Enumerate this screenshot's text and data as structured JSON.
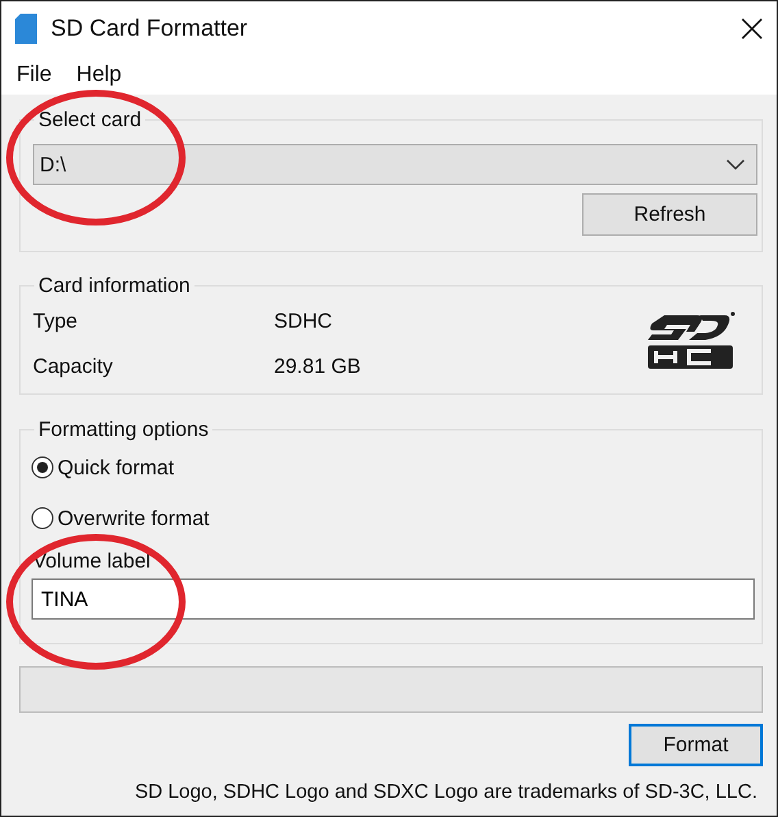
{
  "window": {
    "title": "SD Card Formatter"
  },
  "menu": [
    {
      "label": "File"
    },
    {
      "label": "Help"
    }
  ],
  "select_card": {
    "title": "Select card",
    "value": "D:\\",
    "refresh_button": "Refresh",
    "circled": true
  },
  "card_information": {
    "title": "Card information",
    "rows": [
      {
        "label": "Type",
        "value": "SDHC"
      },
      {
        "label": "Capacity",
        "value": "29.81 GB"
      }
    ]
  },
  "formatting_options": {
    "title": "Formatting options",
    "options": [
      {
        "label": "Quick format",
        "selected": true
      },
      {
        "label": "Overwrite format",
        "selected": false
      }
    ],
    "volume_label": {
      "label": "Volume label",
      "value": "TINA",
      "circled": true
    }
  },
  "progress": {
    "level": 0
  },
  "format_button": {
    "label": "Format",
    "focused": true
  },
  "footer": "SD Logo, SDHC Logo and SDXC Logo are trademarks of SD-3C, LLC."
}
